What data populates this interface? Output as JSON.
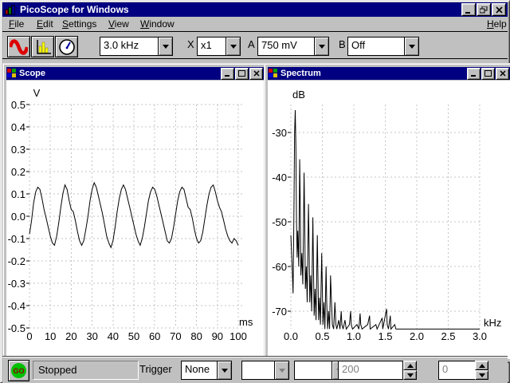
{
  "window": {
    "title": "PicoScope for Windows",
    "controls": {
      "minimize": "minimize",
      "restore": "restore",
      "close": "close"
    }
  },
  "menu": {
    "items": [
      {
        "label": "File"
      },
      {
        "label": "Edit"
      },
      {
        "label": "Settings"
      },
      {
        "label": "View"
      },
      {
        "label": "Window"
      }
    ],
    "right_item": {
      "label": "Help"
    }
  },
  "toolbar": {
    "buttons": [
      {
        "name": "scope-view",
        "icon": "sine-wave-icon"
      },
      {
        "name": "spectrum-view",
        "icon": "bar-spectrum-icon"
      },
      {
        "name": "meter-view",
        "icon": "gauge-icon"
      }
    ],
    "timebase": {
      "value": "3.0 kHz"
    },
    "x_label": "X",
    "x_multiplier": {
      "value": "x1"
    },
    "a_label": "A",
    "channel_a_range": {
      "value": "750 mV"
    },
    "b_label": "B",
    "channel_b_range": {
      "value": "Off"
    }
  },
  "scope_window": {
    "title": "Scope"
  },
  "spectrum_window": {
    "title": "Spectrum"
  },
  "status_bar": {
    "go_label": "GO",
    "status": "Stopped",
    "trigger_label": "Trigger",
    "trigger_mode": {
      "value": "None"
    },
    "trigger_channel": {
      "value": ""
    },
    "trigger_direction": {
      "value": ""
    },
    "trigger_threshold": {
      "value": "200"
    },
    "trigger_delay": {
      "value": "0"
    }
  },
  "colors": {
    "titlebar": "#000080",
    "chrome": "#c0c0c0",
    "plot_bg": "#ffffff",
    "grid": "#c4c4c4",
    "trace": "#000000",
    "go_green": "#00c000",
    "scope_icon_red": "#dd0000",
    "spectrum_icon_yellow": "#ffff00"
  },
  "chart_data": [
    {
      "type": "line",
      "name": "scope",
      "title": "Scope",
      "xlabel": "ms",
      "ylabel": "V",
      "xlim": [
        0,
        100
      ],
      "ylim": [
        -0.5,
        0.5
      ],
      "grid": true,
      "xticks": [
        "0",
        "10",
        "20",
        "30",
        "40",
        "50",
        "60",
        "70",
        "80",
        "90",
        "100"
      ],
      "yticks": [
        "0.5",
        "0.4",
        "0.3",
        "0.2",
        "0.1",
        "0.0",
        "-0.1",
        "-0.2",
        "-0.3",
        "-0.4",
        "-0.5"
      ],
      "x_start": 0,
      "x_step": 1,
      "values": [
        -0.08,
        -0.02,
        0.06,
        0.11,
        0.13,
        0.12,
        0.08,
        0.03,
        -0.01,
        -0.05,
        -0.09,
        -0.12,
        -0.13,
        -0.09,
        -0.03,
        0.04,
        0.1,
        0.14,
        0.12,
        0.07,
        0.03,
        0.02,
        -0.02,
        -0.07,
        -0.11,
        -0.13,
        -0.11,
        -0.06,
        0.0,
        0.07,
        0.12,
        0.15,
        0.13,
        0.09,
        0.05,
        0.01,
        -0.04,
        -0.09,
        -0.12,
        -0.14,
        -0.11,
        -0.05,
        0.02,
        0.08,
        0.12,
        0.14,
        0.12,
        0.08,
        0.04,
        0.0,
        -0.04,
        -0.08,
        -0.11,
        -0.13,
        -0.1,
        -0.05,
        0.01,
        0.07,
        0.11,
        0.13,
        0.12,
        0.09,
        0.05,
        0.01,
        -0.03,
        -0.07,
        -0.11,
        -0.12,
        -0.1,
        -0.05,
        0.01,
        0.07,
        0.11,
        0.13,
        0.12,
        0.08,
        0.04,
        0.03,
        -0.01,
        -0.06,
        -0.1,
        -0.12,
        -0.11,
        -0.07,
        -0.01,
        0.05,
        0.1,
        0.13,
        0.14,
        0.11,
        0.07,
        0.04,
        0.02,
        -0.02,
        -0.06,
        -0.09,
        -0.11,
        -0.12,
        -0.1,
        -0.11,
        -0.13
      ]
    },
    {
      "type": "line",
      "name": "spectrum",
      "title": "Spectrum",
      "xlabel": "kHz",
      "ylabel": "dB",
      "xlim": [
        0,
        3
      ],
      "ylim": [
        -75,
        -24
      ],
      "grid": true,
      "xticks": [
        "0.0",
        "0.5",
        "1.0",
        "1.5",
        "2.0",
        "2.5",
        "3.0"
      ],
      "yticks": [
        "-30",
        "-40",
        "-50",
        "-60",
        "-70"
      ],
      "baseline_db": -74,
      "points": [
        [
          0.0,
          -53
        ],
        [
          0.02,
          -60
        ],
        [
          0.035,
          -66
        ],
        [
          0.05,
          -45
        ],
        [
          0.06,
          -30
        ],
        [
          0.07,
          -25
        ],
        [
          0.08,
          -33
        ],
        [
          0.09,
          -50
        ],
        [
          0.1,
          -58
        ],
        [
          0.11,
          -52
        ],
        [
          0.125,
          -60
        ],
        [
          0.14,
          -36
        ],
        [
          0.15,
          -48
        ],
        [
          0.16,
          -62
        ],
        [
          0.175,
          -57
        ],
        [
          0.19,
          -64
        ],
        [
          0.21,
          -39
        ],
        [
          0.22,
          -50
        ],
        [
          0.23,
          -65
        ],
        [
          0.245,
          -60
        ],
        [
          0.26,
          -68
        ],
        [
          0.28,
          -46
        ],
        [
          0.29,
          -55
        ],
        [
          0.3,
          -68
        ],
        [
          0.315,
          -62
        ],
        [
          0.33,
          -70
        ],
        [
          0.35,
          -49
        ],
        [
          0.36,
          -60
        ],
        [
          0.37,
          -71
        ],
        [
          0.385,
          -65
        ],
        [
          0.4,
          -72
        ],
        [
          0.42,
          -53
        ],
        [
          0.43,
          -62
        ],
        [
          0.44,
          -72
        ],
        [
          0.455,
          -67
        ],
        [
          0.47,
          -73
        ],
        [
          0.49,
          -57
        ],
        [
          0.5,
          -65
        ],
        [
          0.51,
          -73
        ],
        [
          0.525,
          -68
        ],
        [
          0.54,
          -74
        ],
        [
          0.56,
          -60
        ],
        [
          0.57,
          -68
        ],
        [
          0.585,
          -74
        ],
        [
          0.6,
          -70
        ],
        [
          0.615,
          -74
        ],
        [
          0.63,
          -62
        ],
        [
          0.645,
          -68
        ],
        [
          0.66,
          -73
        ],
        [
          0.68,
          -74
        ],
        [
          0.7,
          -68
        ],
        [
          0.715,
          -73
        ],
        [
          0.73,
          -74
        ],
        [
          0.76,
          -72
        ],
        [
          0.78,
          -74
        ],
        [
          0.8,
          -70
        ],
        [
          0.81,
          -73
        ],
        [
          0.83,
          -74
        ],
        [
          0.86,
          -72
        ],
        [
          0.88,
          -74
        ],
        [
          0.93,
          -73
        ],
        [
          0.95,
          -70
        ],
        [
          0.96,
          -73
        ],
        [
          0.98,
          -74
        ],
        [
          1.05,
          -73
        ],
        [
          1.08,
          -74
        ],
        [
          1.1,
          -70.5
        ],
        [
          1.11,
          -73
        ],
        [
          1.13,
          -74
        ],
        [
          1.22,
          -73
        ],
        [
          1.25,
          -71
        ],
        [
          1.26,
          -74
        ],
        [
          1.35,
          -73
        ],
        [
          1.37,
          -74
        ],
        [
          1.45,
          -71.5
        ],
        [
          1.46,
          -74
        ],
        [
          1.52,
          -69.5
        ],
        [
          1.53,
          -73
        ],
        [
          1.55,
          -74
        ],
        [
          1.58,
          -71
        ],
        [
          1.59,
          -74
        ],
        [
          1.65,
          -73
        ],
        [
          1.67,
          -74
        ],
        [
          2.0,
          -74
        ],
        [
          2.5,
          -74
        ],
        [
          3.0,
          -74
        ]
      ]
    }
  ]
}
